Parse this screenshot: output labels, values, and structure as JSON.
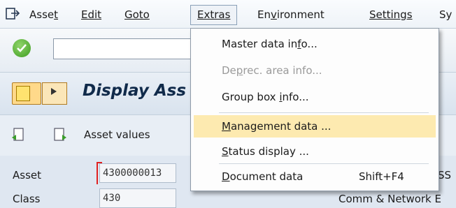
{
  "menubar": {
    "items": [
      {
        "label": "Asset",
        "u": "t",
        "rest": "Asse"
      },
      {
        "label": "Edit"
      },
      {
        "label": "Goto"
      },
      {
        "label": "Extras"
      },
      {
        "label": "Environment"
      },
      {
        "label": "Settings"
      },
      {
        "label": "Sy"
      }
    ]
  },
  "title": "Display Ass",
  "app_toolbar": {
    "asset_values": "Asset values"
  },
  "fields": {
    "asset_label": "Asset",
    "asset_value": "4300000013",
    "class_label": "Class",
    "class_value": "430",
    "right_text_1": "SS",
    "right_text_2": "Comm & Network E"
  },
  "dropdown": {
    "items": [
      {
        "pre": "Master data in",
        "u": "f",
        "post": "o...",
        "shortcut": "",
        "disabled": false,
        "highlighted": false
      },
      {
        "pre": "De",
        "u": "p",
        "post": "rec. area info...",
        "shortcut": "",
        "disabled": true,
        "highlighted": false
      },
      {
        "pre": "Group box ",
        "u": "i",
        "post": "nfo...",
        "shortcut": "",
        "disabled": false,
        "highlighted": false
      },
      {
        "pre": "",
        "u": "M",
        "post": "anagement data ...",
        "shortcut": "",
        "disabled": false,
        "highlighted": true
      },
      {
        "pre": "",
        "u": "S",
        "post": "tatus display ...",
        "shortcut": "",
        "disabled": false,
        "highlighted": false
      },
      {
        "pre": "",
        "u": "D",
        "post": "ocument data",
        "shortcut": "Shift+F4",
        "disabled": false,
        "highlighted": false
      }
    ]
  },
  "colors": {
    "highlight": "#fdeab0",
    "title": "#102a4a",
    "ok_green": "#3f9d21"
  }
}
